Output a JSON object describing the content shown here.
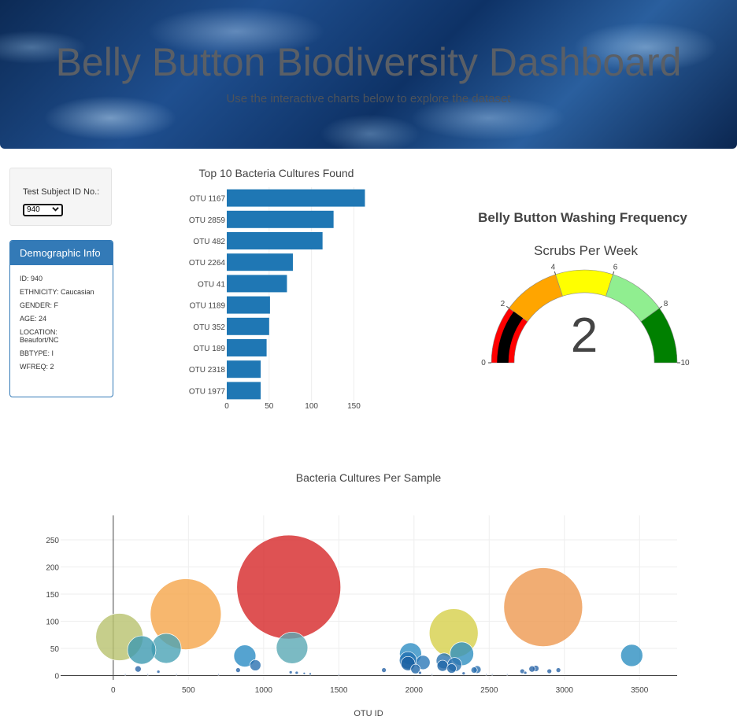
{
  "header": {
    "title": "Belly Button Biodiversity Dashboard",
    "subtitle": "Use the interactive charts below to explore the dataset"
  },
  "selector": {
    "label": "Test Subject ID No.:",
    "selected": "940"
  },
  "demographics": {
    "heading": "Demographic Info",
    "rows": [
      "ID: 940",
      "ETHNICITY: Caucasian",
      "GENDER: F",
      "AGE: 24",
      "LOCATION: Beaufort/NC",
      "BBTYPE: I",
      "WFREQ: 2"
    ]
  },
  "chart_data": [
    {
      "type": "bar",
      "orientation": "horizontal",
      "title": "Top 10 Bacteria Cultures Found",
      "categories": [
        "OTU 1167",
        "OTU 2859",
        "OTU 482",
        "OTU 2264",
        "OTU 41",
        "OTU 1189",
        "OTU 352",
        "OTU 189",
        "OTU 2318",
        "OTU 1977"
      ],
      "values": [
        163,
        126,
        113,
        78,
        71,
        51,
        50,
        47,
        40,
        40
      ],
      "xlim": [
        0,
        170
      ],
      "xticks": [
        0,
        50,
        100,
        150
      ],
      "color": "#1f77b4"
    },
    {
      "type": "gauge",
      "title": "Belly Button Washing Frequency",
      "subtitle": "Scrubs Per Week",
      "value": 2,
      "range": [
        0,
        10
      ],
      "ticks": [
        0,
        2,
        4,
        6,
        8,
        10
      ],
      "steps": [
        {
          "range": [
            0,
            2
          ],
          "color": "#ff0000"
        },
        {
          "range": [
            2,
            4
          ],
          "color": "#ffa500"
        },
        {
          "range": [
            4,
            6
          ],
          "color": "#ffff00"
        },
        {
          "range": [
            6,
            8
          ],
          "color": "#90ee90"
        },
        {
          "range": [
            8,
            10
          ],
          "color": "#008000"
        }
      ],
      "bar_color": "#000000"
    },
    {
      "type": "scatter",
      "title": "Bacteria Cultures Per Sample",
      "xlabel": "OTU ID",
      "ylabel": "",
      "xlim": [
        -350,
        3750
      ],
      "ylim": [
        -8,
        295
      ],
      "xticks": [
        0,
        500,
        1000,
        1500,
        2000,
        2500,
        3000,
        3500
      ],
      "yticks": [
        0,
        50,
        100,
        150,
        200,
        250
      ],
      "points": [
        {
          "x": 1167,
          "y": 163,
          "r": 66,
          "color": "#d62728"
        },
        {
          "x": 482,
          "y": 113,
          "r": 45,
          "color": "#f5a54a"
        },
        {
          "x": 2859,
          "y": 126,
          "r": 50,
          "color": "#ee9850"
        },
        {
          "x": 41,
          "y": 71,
          "r": 30,
          "color": "#b8c26e"
        },
        {
          "x": 2264,
          "y": 78,
          "r": 31,
          "color": "#d6cf4a"
        },
        {
          "x": 189,
          "y": 47,
          "r": 18,
          "color": "#3d9ab0"
        },
        {
          "x": 352,
          "y": 50,
          "r": 19,
          "color": "#4aa3b5"
        },
        {
          "x": 1189,
          "y": 51,
          "r": 20,
          "color": "#5aa9b4"
        },
        {
          "x": 3448,
          "y": 37,
          "r": 14,
          "color": "#2d8fc0"
        },
        {
          "x": 875,
          "y": 36,
          "r": 14,
          "color": "#2b8cc4"
        },
        {
          "x": 1977,
          "y": 40,
          "r": 14,
          "color": "#2f8ec4"
        },
        {
          "x": 2318,
          "y": 40,
          "r": 15,
          "color": "#2f90c0"
        },
        {
          "x": 1960,
          "y": 28,
          "r": 11,
          "color": "#1f6fb0"
        },
        {
          "x": 2060,
          "y": 24,
          "r": 9,
          "color": "#2a78b8"
        },
        {
          "x": 2200,
          "y": 27,
          "r": 10,
          "color": "#2a74b0"
        },
        {
          "x": 2270,
          "y": 20,
          "r": 9,
          "color": "#2a74b0"
        },
        {
          "x": 945,
          "y": 19,
          "r": 7,
          "color": "#2a70b0"
        },
        {
          "x": 1960,
          "y": 22,
          "r": 9,
          "color": "#1a5fa0"
        },
        {
          "x": 2190,
          "y": 18,
          "r": 7,
          "color": "#1f66a8"
        },
        {
          "x": 2250,
          "y": 13,
          "r": 6,
          "color": "#1f66a8"
        },
        {
          "x": 2010,
          "y": 12,
          "r": 6,
          "color": "#1f66a8"
        },
        {
          "x": 165,
          "y": 12,
          "r": 4,
          "color": "#2a65a8"
        },
        {
          "x": 830,
          "y": 10,
          "r": 3,
          "color": "#2a65a8"
        },
        {
          "x": 1800,
          "y": 10,
          "r": 3,
          "color": "#2a65a8"
        },
        {
          "x": 2420,
          "y": 11,
          "r": 5,
          "color": "#2a70b0"
        },
        {
          "x": 2400,
          "y": 10,
          "r": 4,
          "color": "#2a70b0"
        },
        {
          "x": 2810,
          "y": 13,
          "r": 4,
          "color": "#2a65a8"
        },
        {
          "x": 2785,
          "y": 12,
          "r": 4,
          "color": "#2a65a8"
        },
        {
          "x": 2960,
          "y": 10,
          "r": 3,
          "color": "#2a65a8"
        },
        {
          "x": 2900,
          "y": 8,
          "r": 3,
          "color": "#2a65a8"
        },
        {
          "x": 2720,
          "y": 8,
          "r": 3,
          "color": "#2a65a8"
        },
        {
          "x": 300,
          "y": 7,
          "r": 2,
          "color": "#2a65a8"
        },
        {
          "x": 1180,
          "y": 6,
          "r": 2,
          "color": "#2a65a8"
        },
        {
          "x": 1220,
          "y": 5,
          "r": 2,
          "color": "#2a65a8"
        },
        {
          "x": 1270,
          "y": 4,
          "r": 1.5,
          "color": "#2a65a8"
        },
        {
          "x": 1310,
          "y": 3,
          "r": 1.5,
          "color": "#2a65a8"
        },
        {
          "x": 2040,
          "y": 5,
          "r": 2,
          "color": "#2a65a8"
        },
        {
          "x": 2330,
          "y": 4,
          "r": 2,
          "color": "#2a65a8"
        },
        {
          "x": 2740,
          "y": 5,
          "r": 2,
          "color": "#2a65a8"
        },
        {
          "x": 80,
          "y": 2,
          "r": 1,
          "color": "#6a8ab8"
        },
        {
          "x": 230,
          "y": 2,
          "r": 1,
          "color": "#6a8ab8"
        },
        {
          "x": 420,
          "y": 2,
          "r": 1,
          "color": "#6a8ab8"
        },
        {
          "x": 700,
          "y": 2,
          "r": 1,
          "color": "#6a8ab8"
        },
        {
          "x": 1500,
          "y": 2,
          "r": 1,
          "color": "#6a8ab8"
        },
        {
          "x": 2120,
          "y": 2,
          "r": 1,
          "color": "#6a8ab8"
        },
        {
          "x": 2480,
          "y": 2,
          "r": 1,
          "color": "#6a8ab8"
        },
        {
          "x": 2520,
          "y": 2,
          "r": 1,
          "color": "#6a8ab8"
        },
        {
          "x": 2620,
          "y": 2,
          "r": 1,
          "color": "#6a8ab8"
        }
      ]
    }
  ]
}
